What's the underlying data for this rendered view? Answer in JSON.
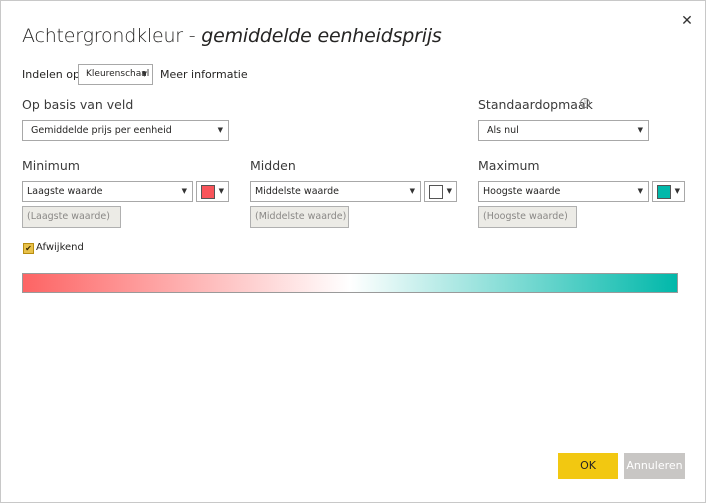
{
  "dialog": {
    "title_main": "Achtergrondkleur - ",
    "title_field": "gemiddelde eenheidsprijs",
    "close_glyph": "✕"
  },
  "format_by": {
    "label": "Indelen op",
    "value": "Kleurenschaal",
    "more_info_link": "Meer informatie"
  },
  "based_on_field": {
    "label": "Op basis van veld",
    "value": "Gemiddelde prijs per eenheid"
  },
  "default_format": {
    "label": "Standaardopmaak",
    "value": "Als nul",
    "info_glyph": "i"
  },
  "minimum": {
    "label": "Minimum",
    "select_value": "Laagste waarde",
    "input_placeholder": "(Laagste waarde)",
    "color": "#f8545a"
  },
  "center": {
    "label": "Midden",
    "select_value": "Middelste waarde",
    "input_placeholder": "(Middelste waarde)",
    "color": "#ffffff"
  },
  "maximum": {
    "label": "Maximum",
    "select_value": "Hoogste waarde",
    "input_placeholder": "(Hoogste waarde)",
    "color": "#01b8aa"
  },
  "diverging": {
    "label": "Afwijkend",
    "checked": true,
    "check_glyph": "✔"
  },
  "gradient": {
    "start_color": "#fd6464",
    "middle_color": "#ffffff",
    "end_color": "#01b8aa"
  },
  "buttons": {
    "ok_label": "OK",
    "cancel_label": "Annuleren"
  },
  "icons": {
    "dropdown_arrow": "▼"
  }
}
